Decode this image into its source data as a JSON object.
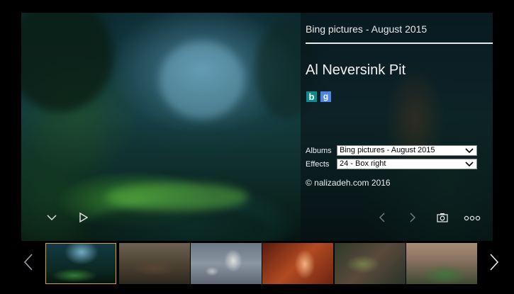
{
  "info": {
    "album_heading": "Bing pictures - August 2015",
    "photo_title": "Al Neversink Pit",
    "bing_icon_glyph": "b",
    "google_icon_glyph": "g",
    "albums_label": "Albums",
    "albums_value": "Bing pictures - August 2015",
    "effects_label": "Effects",
    "effects_value": "24 - Box right",
    "copyright": "© nalizadeh.com 2016"
  },
  "icons": {
    "collapse": "chevron-down-icon",
    "play": "play-icon",
    "prev": "chevron-left-icon",
    "next": "chevron-right-icon",
    "camera": "camera-icon",
    "more": "more-icon",
    "strip_prev": "chevron-left-icon",
    "strip_next": "chevron-right-icon"
  },
  "colors": {
    "selected_thumb_border": "#e0a030",
    "bing_badge": "#0f8a8a",
    "google_badge": "#4a86e8"
  }
}
